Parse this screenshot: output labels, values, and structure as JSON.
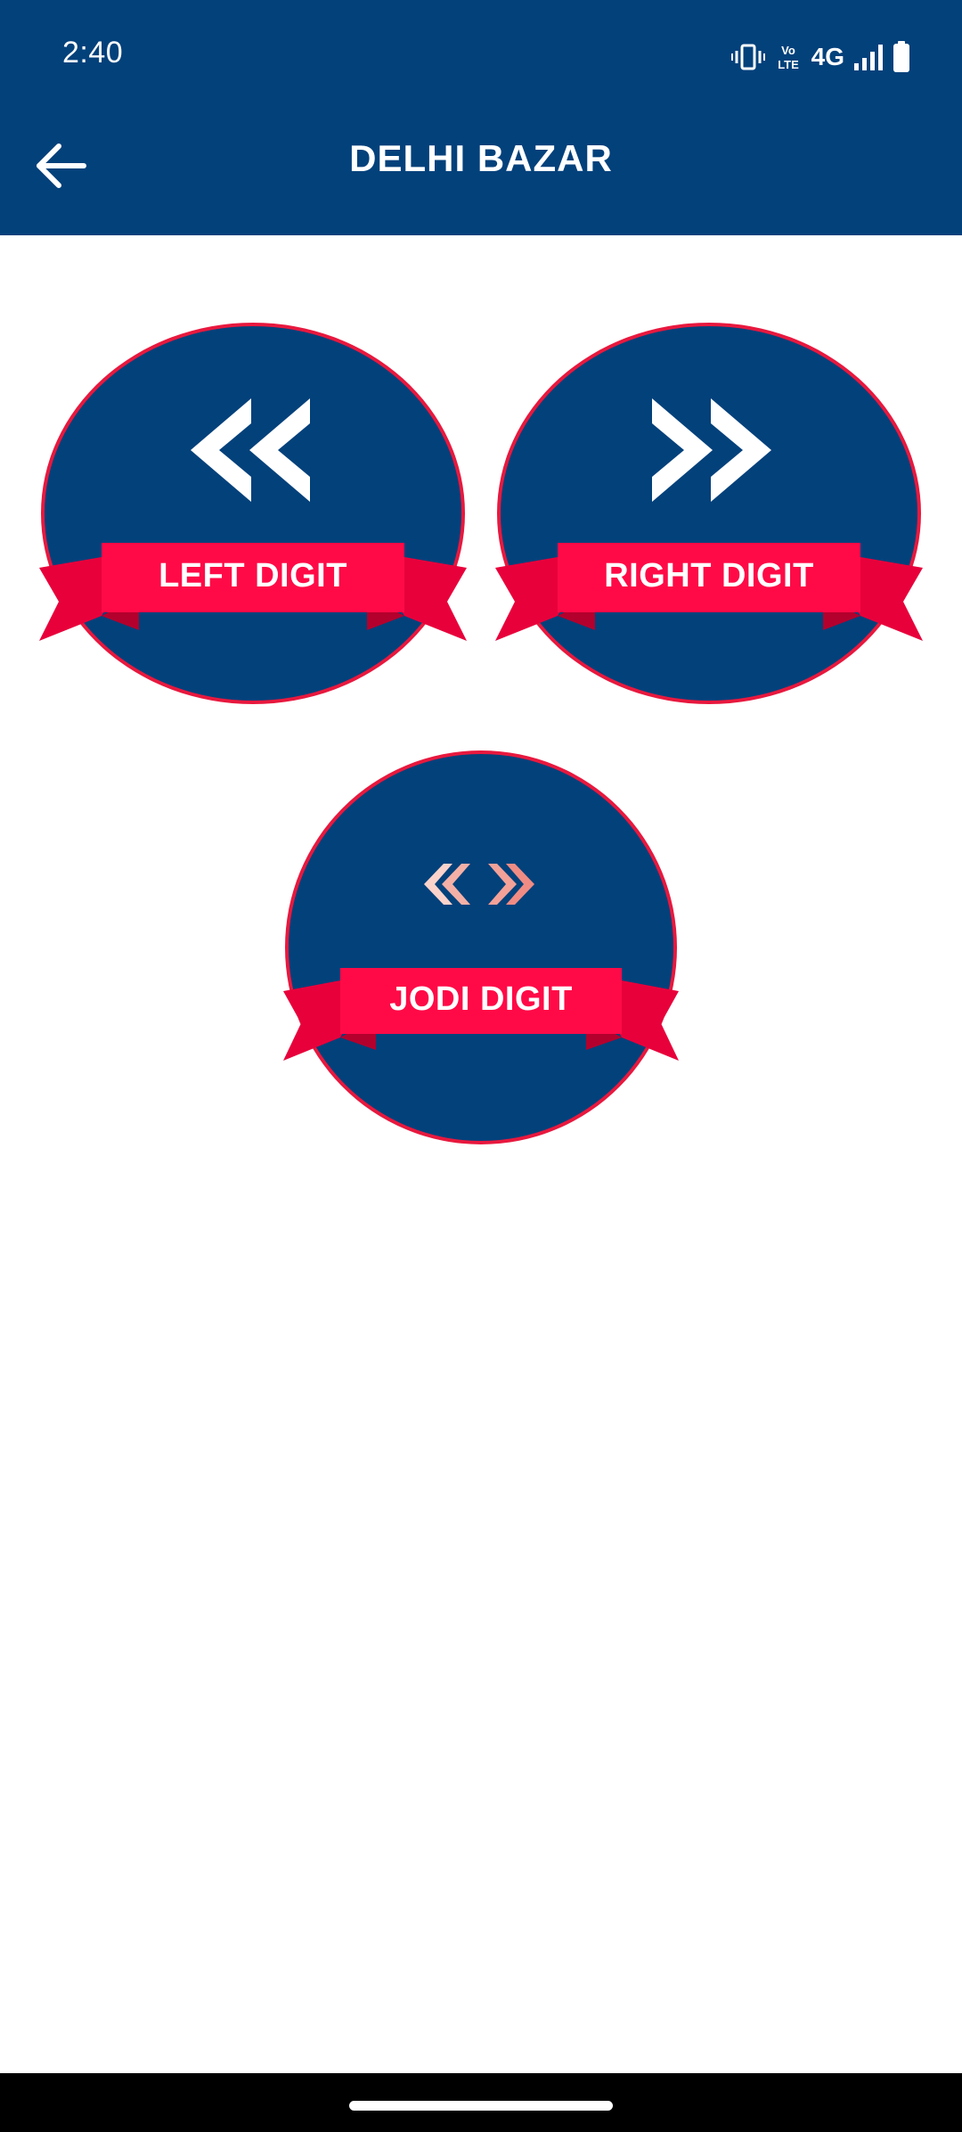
{
  "status_bar": {
    "time": "2:40",
    "network": "4G",
    "icons": [
      "vibrate-icon",
      "volte-icon",
      "signal-icon",
      "battery-icon"
    ]
  },
  "header": {
    "title": "DELHI BAZAR",
    "back_icon": "arrow-left-icon"
  },
  "options": [
    {
      "label": "LEFT DIGIT",
      "icon": "double-chevron-left-icon"
    },
    {
      "label": "RIGHT DIGIT",
      "icon": "double-chevron-right-icon"
    },
    {
      "label": "JODI DIGIT",
      "icon": "chevrons-in-out-icon"
    }
  ],
  "colors": {
    "primary": "#03417b",
    "accent": "#ff0a47",
    "circle_border": "#e8183e",
    "jodi_chevron_light": "#fbd3cb",
    "jodi_chevron_dark": "#f08c84"
  }
}
